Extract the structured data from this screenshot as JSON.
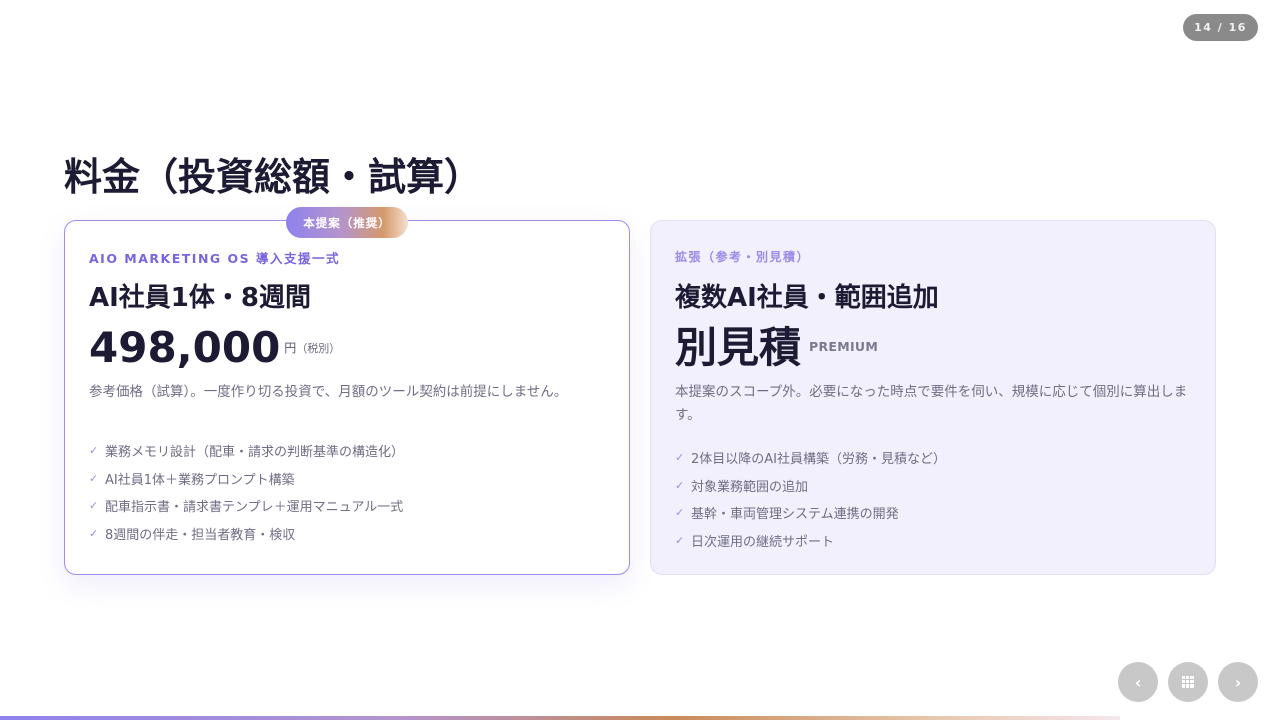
{
  "pagination": {
    "counter": "14 / 16"
  },
  "title": "料金（投資総額・試算）",
  "plans": {
    "main": {
      "badge": "本提案（推奨）",
      "eyebrow": "AIO MARKETING OS 導入支援一式",
      "title": "AI社員1体・8週間",
      "price": "498,000",
      "price_unit": "円",
      "price_note": "（税別）",
      "description": "参考価格（試算）。一度作り切る投資で、月額のツール契約は前提にしません。",
      "features": [
        "業務メモリ設計（配車・請求の判断基準の構造化）",
        "AI社員1体＋業務プロンプト構築",
        "配車指示書・請求書テンプレ＋運用マニュアル一式",
        "8週間の伴走・担当者教育・検収"
      ]
    },
    "extension": {
      "eyebrow": "拡張（参考・別見積）",
      "title": "複数AI社員・範囲追加",
      "price": "別見積",
      "price_tag": "PREMIUM",
      "description": "本提案のスコープ外。必要になった時点で要件を伺い、規模に応じて個別に算出します。",
      "features": [
        "2体目以降のAI社員構築（労務・見積など）",
        "対象業務範囲の追加",
        "基幹・車両管理システム連携の開発",
        "日次運用の継続サポート"
      ]
    }
  },
  "icons": {
    "check": "✓",
    "prev": "‹",
    "next": "›",
    "grid": "grid-icon"
  },
  "progress": {
    "value": 0.875
  },
  "colors": {
    "accent": "#7766dd",
    "title": "#1c1b33",
    "card_border": "#9a8ef0",
    "extension_bg": "#f2f0fc"
  }
}
